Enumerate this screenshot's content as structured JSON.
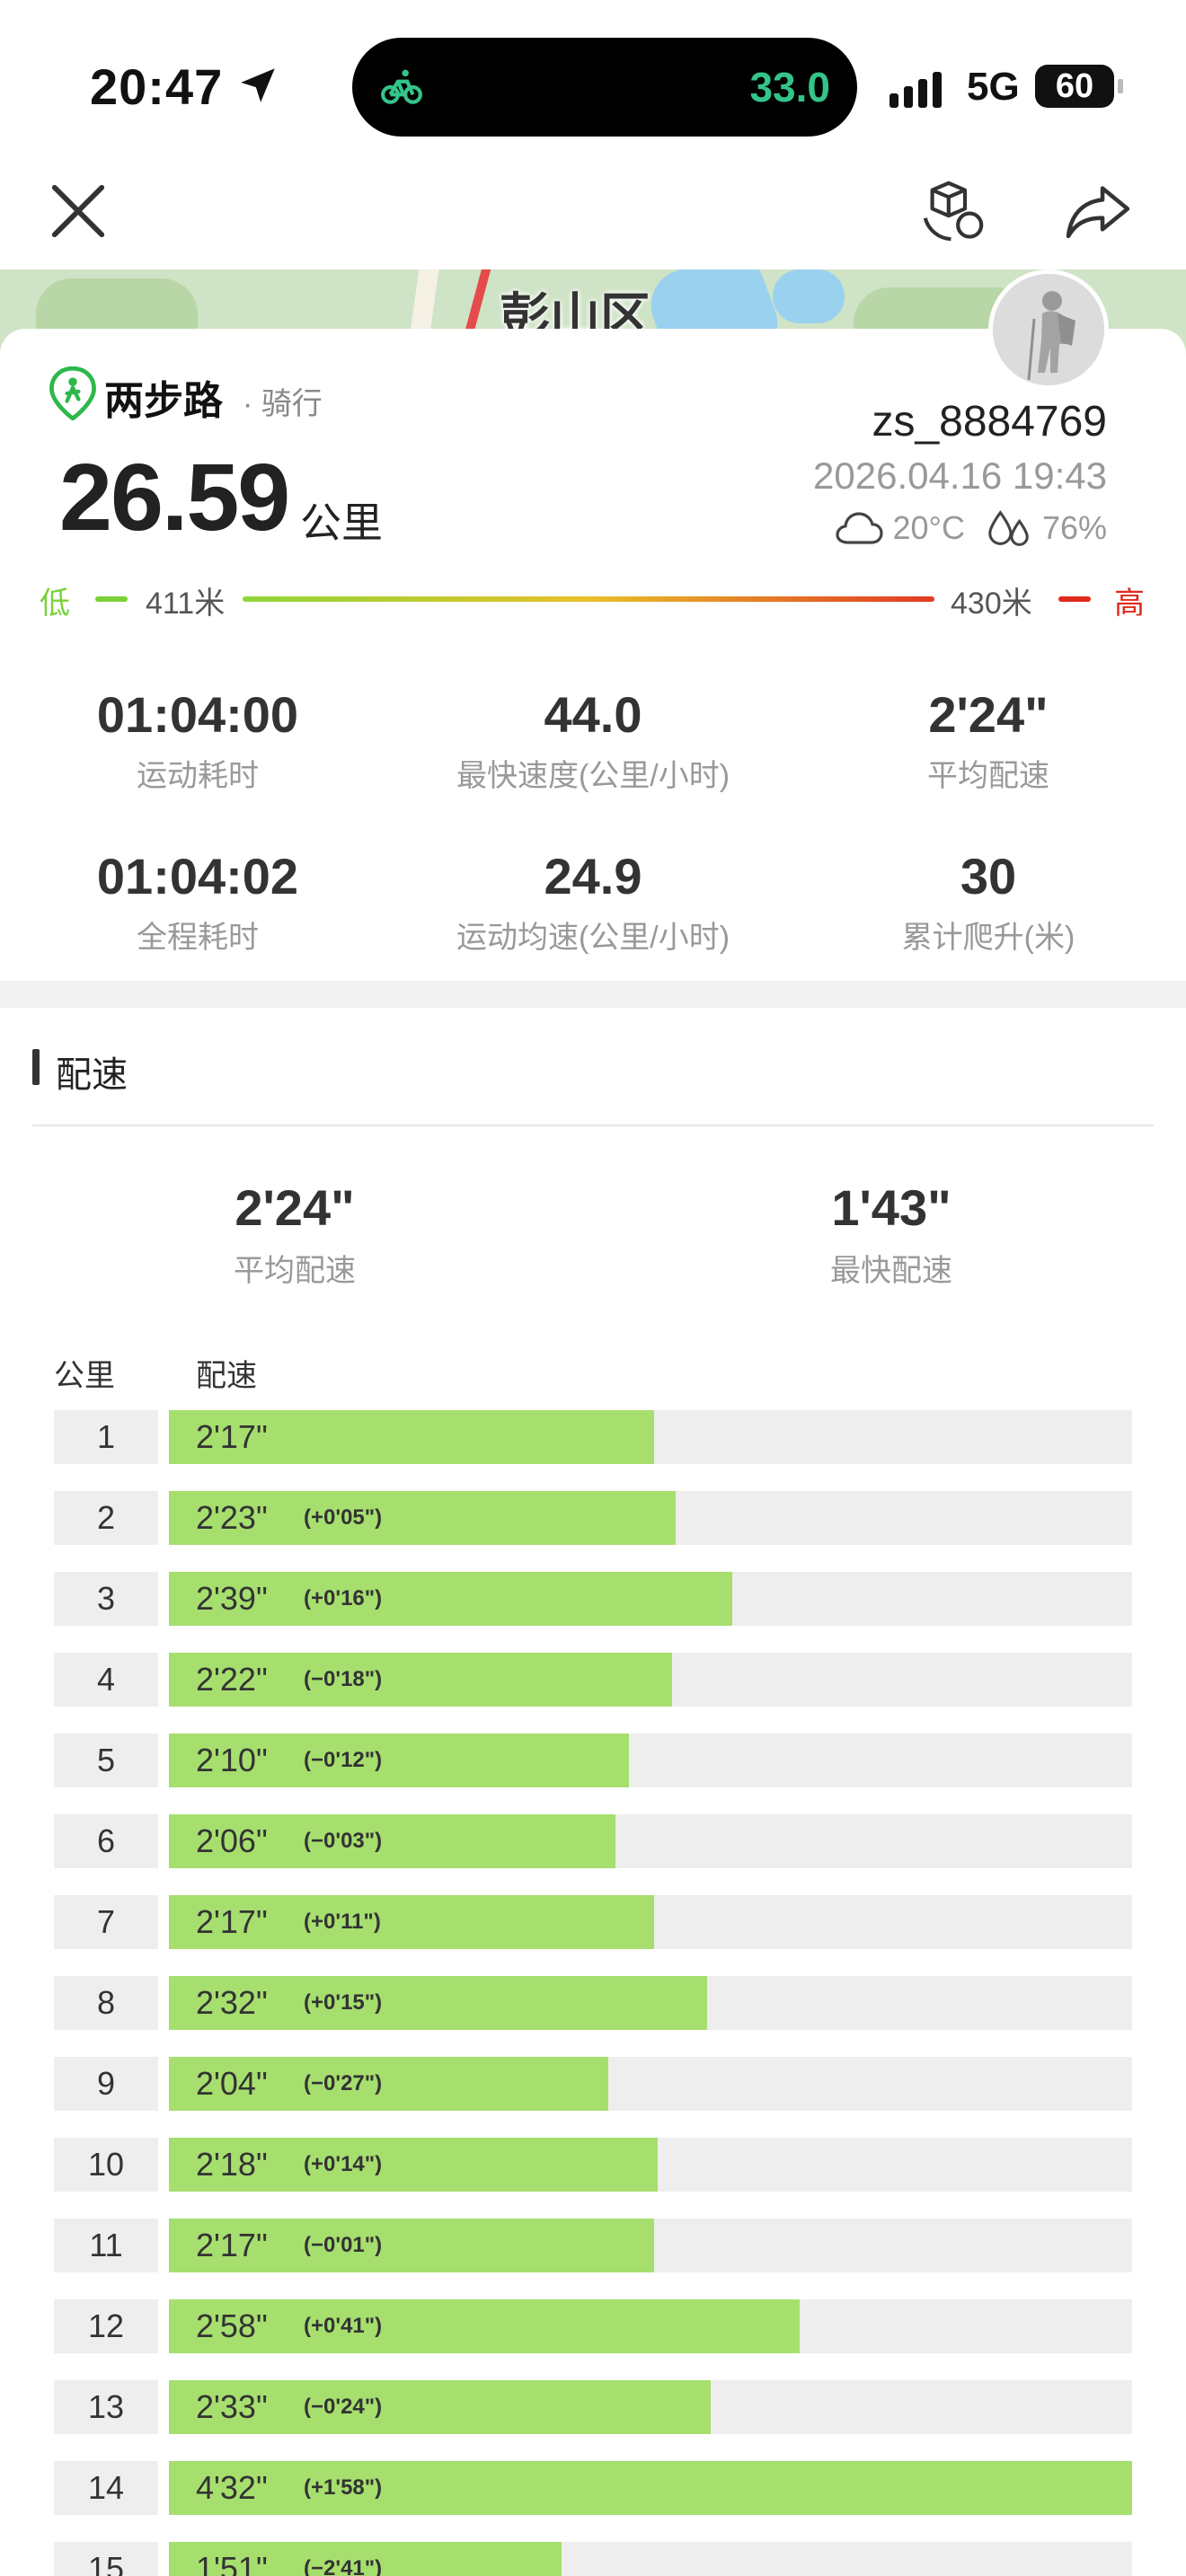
{
  "status": {
    "time": "20:47",
    "island_speed": "33.0",
    "network": "5G",
    "battery": "60"
  },
  "map": {
    "label": "彭山区"
  },
  "summary": {
    "brand": "两步路",
    "activity": "· 骑行",
    "distance": "26.59",
    "distance_unit": "公里",
    "username": "zs_8884769",
    "datetime": "2026.04.16 19:43",
    "temperature": "20°C",
    "humidity": "76%"
  },
  "elevation": {
    "low_label": "低",
    "min": "411米",
    "max": "430米",
    "high_label": "高"
  },
  "stats": [
    {
      "value": "01:04:00",
      "label": "运动耗时"
    },
    {
      "value": "44.0",
      "label": "最快速度(公里/小时)"
    },
    {
      "value": "2'24\"",
      "label": "平均配速"
    },
    {
      "value": "01:04:02",
      "label": "全程耗时"
    },
    {
      "value": "24.9",
      "label": "运动均速(公里/小时)"
    },
    {
      "value": "30",
      "label": "累计爬升(米)"
    }
  ],
  "pace_section": {
    "title": "配速",
    "avg_value": "2'24\"",
    "avg_label": "平均配速",
    "fast_value": "1'43\"",
    "fast_label": "最快配速",
    "col_km": "公里",
    "col_pace": "配速",
    "max_pace_seconds": 272,
    "rows": [
      {
        "km": "1",
        "pace": "2'17\"",
        "diff": "",
        "seconds": 137
      },
      {
        "km": "2",
        "pace": "2'23\"",
        "diff": "(+0'05\")",
        "seconds": 143
      },
      {
        "km": "3",
        "pace": "2'39\"",
        "diff": "(+0'16\")",
        "seconds": 159
      },
      {
        "km": "4",
        "pace": "2'22\"",
        "diff": "(−0'18\")",
        "seconds": 142
      },
      {
        "km": "5",
        "pace": "2'10\"",
        "diff": "(−0'12\")",
        "seconds": 130
      },
      {
        "km": "6",
        "pace": "2'06\"",
        "diff": "(−0'03\")",
        "seconds": 126
      },
      {
        "km": "7",
        "pace": "2'17\"",
        "diff": "(+0'11\")",
        "seconds": 137
      },
      {
        "km": "8",
        "pace": "2'32\"",
        "diff": "(+0'15\")",
        "seconds": 152
      },
      {
        "km": "9",
        "pace": "2'04\"",
        "diff": "(−0'27\")",
        "seconds": 124
      },
      {
        "km": "10",
        "pace": "2'18\"",
        "diff": "(+0'14\")",
        "seconds": 138
      },
      {
        "km": "11",
        "pace": "2'17\"",
        "diff": "(−0'01\")",
        "seconds": 137
      },
      {
        "km": "12",
        "pace": "2'58\"",
        "diff": "(+0'41\")",
        "seconds": 178
      },
      {
        "km": "13",
        "pace": "2'33\"",
        "diff": "(−0'24\")",
        "seconds": 153
      },
      {
        "km": "14",
        "pace": "4'32\"",
        "diff": "(+1'58\")",
        "seconds": 272
      },
      {
        "km": "15",
        "pace": "1'51\"",
        "diff": "(−2'41\")",
        "seconds": 111
      }
    ]
  },
  "colors": {
    "bar_fill": "#a6df6e",
    "low": "#7ad03a",
    "high": "#e02a1c",
    "island_speed": "#34c48a"
  }
}
